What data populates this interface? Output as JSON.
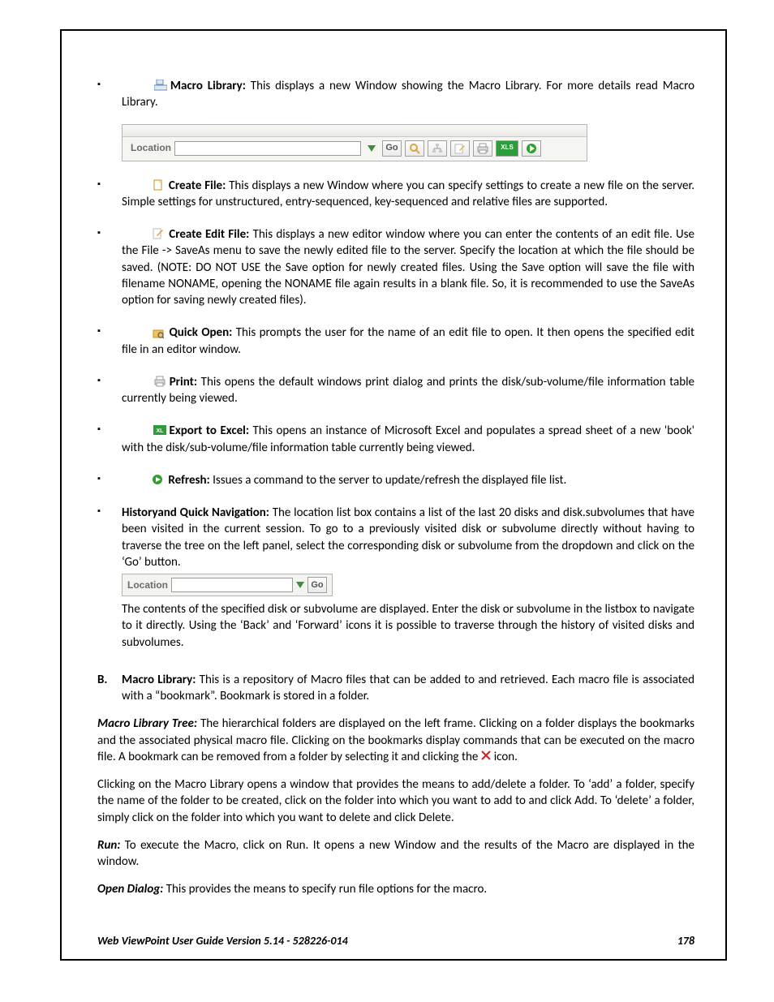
{
  "items": [
    {
      "icon": "macro-library-icon",
      "title": "Macro Library:",
      "text": " This displays a new Window showing the Macro Library. For more details read Macro Library."
    },
    {
      "icon": "create-file-icon",
      "title": "Create File:",
      "text": " This displays a new Window where you can specify settings to create a new file on the server. Simple settings for unstructured, entry-sequenced, key-sequenced and relative files are supported."
    },
    {
      "icon": "create-edit-file-icon",
      "title": "Create Edit File:",
      "text": "  This displays a new editor window where you can enter the contents of an edit file. Use the File -> SaveAs menu to save the newly edited file to the server. Specify the location at which the file should be saved. (NOTE: DO NOT USE the Save option for newly created files. Using the Save option will save the file with filename NONAME, opening the NONAME file again results in a blank file. So, it is recommended to use the SaveAs option for saving newly created files)."
    },
    {
      "icon": "quick-open-icon",
      "title": "Quick Open:",
      "text": "  This prompts the user for the name of an edit file to open. It then opens the specified edit file in an editor window."
    },
    {
      "icon": "print-icon",
      "title": "Print:",
      "text": " This opens the default windows print dialog and prints the disk/sub-volume/file information table currently being viewed."
    },
    {
      "icon": "export-excel-icon",
      "title": "Export to Excel:",
      "text": " This opens an instance of Microsoft Excel and populates a spread sheet of a new 'book' with the disk/sub-volume/file information table currently being viewed."
    },
    {
      "icon": "refresh-icon",
      "title": "Refresh:",
      "text": " Issues a command to the server to update/refresh the displayed file list."
    },
    {
      "icon": "",
      "title": "Historyand Quick Navigation:",
      "text": " The location list box contains a list of the last 20 disks and disk.subvolumes that have been visited in the current session. To go to a previously visited disk or subvolume directly without having to traverse the tree on the left panel, select the corresponding disk or subvolume from the dropdown and click on the ‘Go’ button."
    }
  ],
  "history_tail": "The contents of the specified disk or subvolume are displayed. Enter the disk or subvolume in the listbox to navigate to it directly. Using the ‘Back’ and ‘Forward’ icons it is possible to traverse through the history of visited disks and subvolumes.",
  "section_b": {
    "label": "B.",
    "title": "Macro Library:",
    "text": " This is a repository of Macro files that can be added to and retrieved. Each macro file is associated with a “bookmark”. Bookmark is stored in a folder."
  },
  "macro_tree_title": "Macro Library Tree:",
  "macro_tree_text_a": " The hierarchical folders are displayed on the left frame. Clicking on a folder displays the bookmarks and the associated physical macro file. Clicking on the bookmarks display commands that can be executed on the macro file. A bookmark can be removed from a folder by selecting it and clicking the ",
  "macro_tree_text_b": "icon.",
  "macro_open_text": "Clicking on the Macro Library opens a window that provides the means to add/delete a folder. To ‘add’ a folder, specify the name of the folder to be created, click on the folder into which you want to add to and click Add. To ‘delete’ a folder, simply click on the folder into which you want to delete and click Delete.",
  "run_title": "Run:",
  "run_text": " To execute the Macro, click on Run. It opens a new Window and the results of the Macro are displayed in the window.",
  "open_dialog_title": "Open Dialog:",
  "open_dialog_text": " This provides the means to specify run file options for the macro.",
  "toolbar": {
    "location_label": "Location",
    "go_label": "Go",
    "xls_label": "XLS"
  },
  "footer": {
    "left": "Web ViewPoint User Guide Version 5.14 - 528226-014",
    "right": "178"
  }
}
